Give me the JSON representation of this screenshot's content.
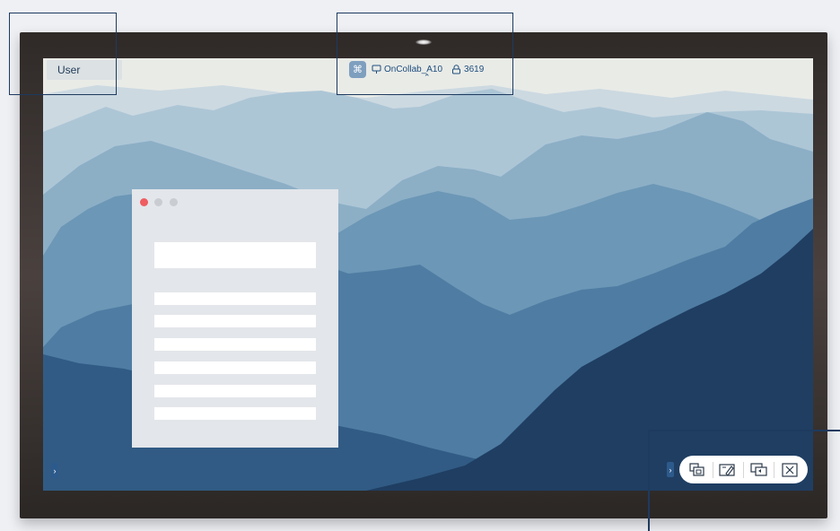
{
  "user_label": "User",
  "top_bar": {
    "app_icon": "command-icon",
    "device_icon": "display-icon",
    "device_name": "OnCollab_A10",
    "lock_icon": "lock-icon",
    "code": "3619",
    "expand_icon": "chevron-up-icon"
  },
  "window_controls": {
    "close_color": "#ef5c61",
    "inactive_color": "#c9ccd1"
  },
  "left_handle_icon": "chevron-right-icon",
  "toolbar": {
    "expand_icon": "chevron-right-icon",
    "tools": [
      "screen-share-icon",
      "pen-annotate-icon",
      "screen-switch-icon",
      "close-icon"
    ]
  },
  "colors": {
    "accent": "#2d5a8c",
    "annotation": "#1e3a5f"
  }
}
